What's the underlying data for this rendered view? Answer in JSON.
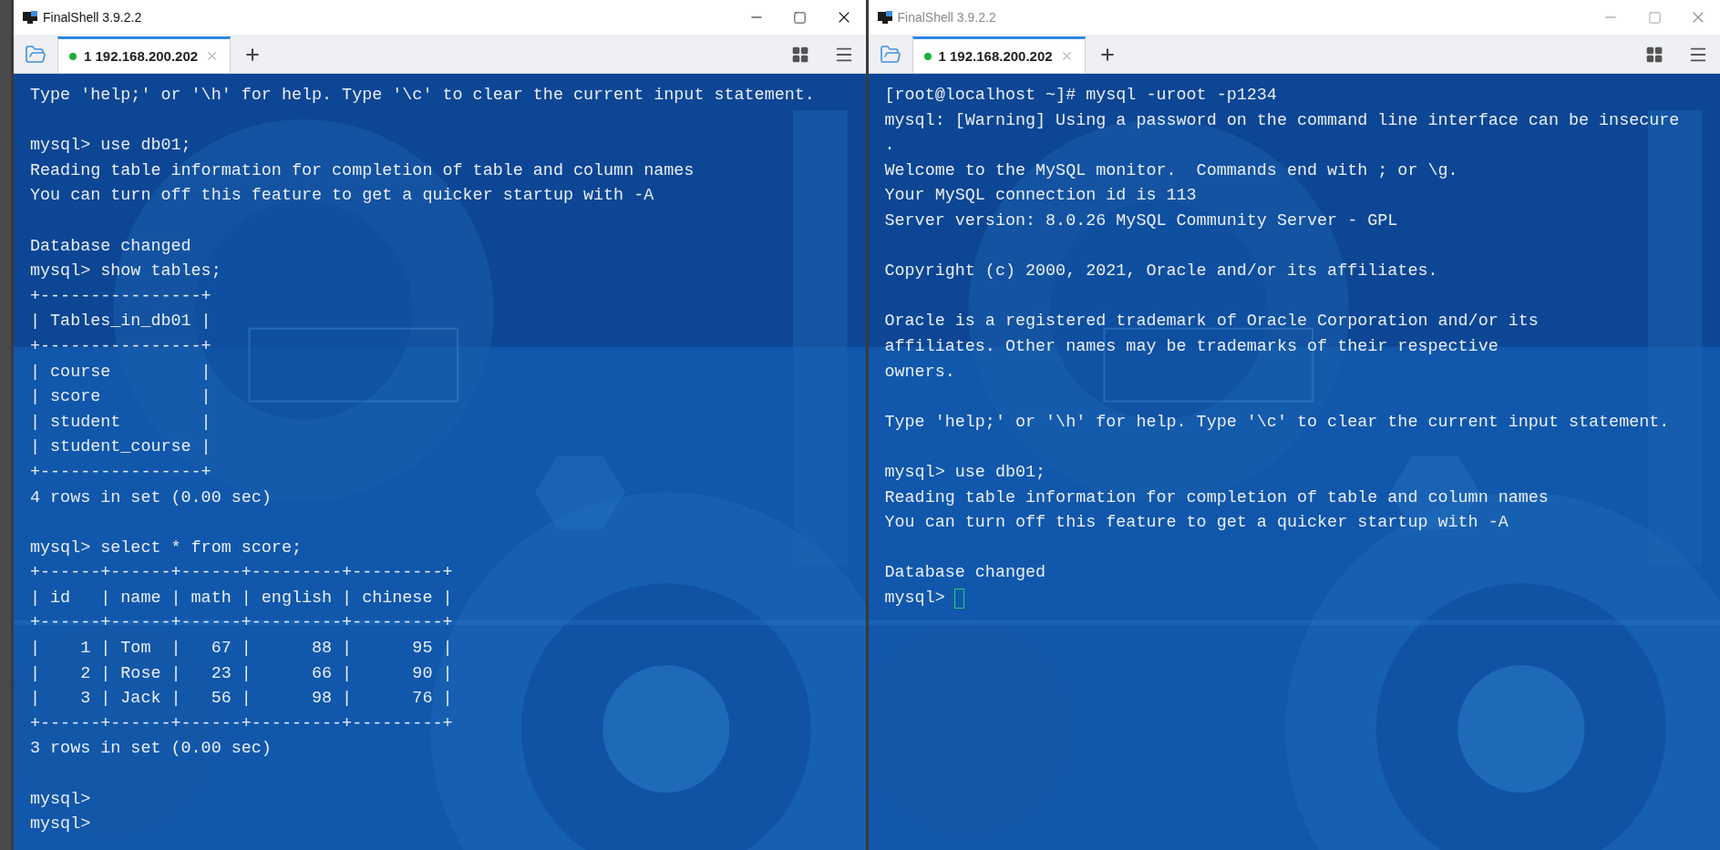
{
  "windows": [
    {
      "title": "FinalShell 3.9.2.2",
      "active": true,
      "tabs": [
        {
          "label": "1 192.168.200.202",
          "selected": true,
          "connected": true
        }
      ],
      "terminal": {
        "cursor": false,
        "blocks": [
          [
            "Type 'help;' or '\\h' for help. Type '\\c' to clear the current input statement."
          ],
          [
            "mysql> use db01;",
            "Reading table information for completion of table and column names",
            "You can turn off this feature to get a quicker startup with -A"
          ],
          [
            "Database changed",
            "mysql> show tables;",
            "+----------------+",
            "| Tables_in_db01 |",
            "+----------------+",
            "| course         |",
            "| score          |",
            "| student        |",
            "| student_course |",
            "+----------------+",
            "4 rows in set (0.00 sec)"
          ],
          [
            "mysql> select * from score;",
            "+------+------+------+---------+---------+",
            "| id   | name | math | english | chinese |",
            "+------+------+------+---------+---------+",
            "|    1 | Tom  |   67 |      88 |      95 |",
            "|    2 | Rose |   23 |      66 |      90 |",
            "|    3 | Jack |   56 |      98 |      76 |",
            "+------+------+------+---------+---------+",
            "3 rows in set (0.00 sec)"
          ],
          [
            "mysql>",
            "mysql>"
          ]
        ]
      }
    },
    {
      "title": "FinalShell 3.9.2.2",
      "active": false,
      "tabs": [
        {
          "label": "1 192.168.200.202",
          "selected": true,
          "connected": true
        }
      ],
      "terminal": {
        "cursor": true,
        "blocks": [
          [
            "[root@localhost ~]# mysql -uroot -p1234",
            "mysql: [Warning] Using a password on the command line interface can be insecure",
            ".",
            "Welcome to the MySQL monitor.  Commands end with ; or \\g.",
            "Your MySQL connection id is 113",
            "Server version: 8.0.26 MySQL Community Server - GPL"
          ],
          [
            "Copyright (c) 2000, 2021, Oracle and/or its affiliates."
          ],
          [
            "Oracle is a registered trademark of Oracle Corporation and/or its",
            "affiliates. Other names may be trademarks of their respective",
            "owners."
          ],
          [
            "Type 'help;' or '\\h' for help. Type '\\c' to clear the current input statement."
          ],
          [
            "mysql> use db01;",
            "Reading table information for completion of table and column names",
            "You can turn off this feature to get a quicker startup with -A"
          ],
          [
            "Database changed",
            "mysql>"
          ]
        ]
      }
    }
  ]
}
